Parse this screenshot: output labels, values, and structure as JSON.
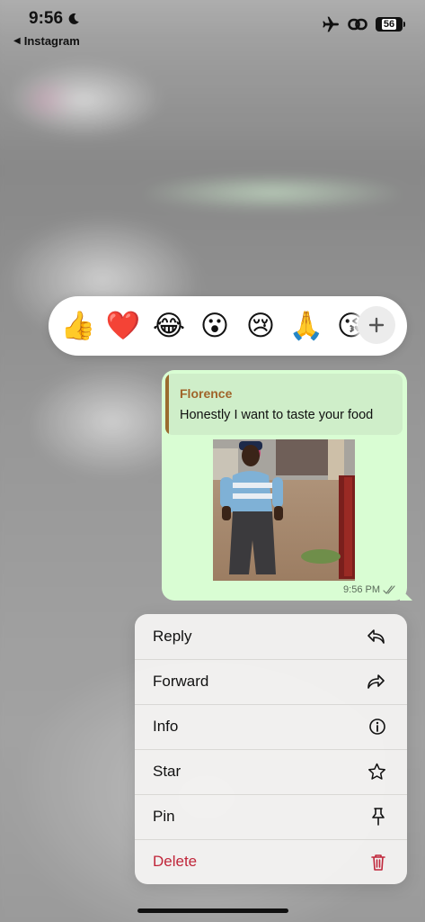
{
  "status_bar": {
    "time": "9:56",
    "back_app": "Instagram",
    "battery": "56"
  },
  "reactions": {
    "items": [
      {
        "emoji": "👍",
        "name": "thumbs-up"
      },
      {
        "emoji": "❤️",
        "name": "red-heart"
      },
      {
        "emoji": "😂",
        "name": "tears-of-joy"
      },
      {
        "emoji": "😮",
        "name": "open-mouth"
      },
      {
        "emoji": "😢",
        "name": "crying-face"
      },
      {
        "emoji": "🙏",
        "name": "folded-hands"
      },
      {
        "emoji": "😘",
        "name": "face-blowing-kiss"
      }
    ],
    "add_icon": "plus-icon"
  },
  "message": {
    "quoted_author": "Florence",
    "quoted_text": "Honestly I want to taste your food",
    "image_description_icon": "photo",
    "time": "9:56 PM",
    "status_icon": "double-check-icon",
    "colors": {
      "bubble": "#d9fdd3",
      "quote_author": "#a0642a",
      "quote_bar": "#9a6b2f"
    }
  },
  "menu": {
    "items": [
      {
        "label": "Reply",
        "icon": "reply-icon"
      },
      {
        "label": "Forward",
        "icon": "forward-icon"
      },
      {
        "label": "Info",
        "icon": "info-icon"
      },
      {
        "label": "Star",
        "icon": "star-icon"
      },
      {
        "label": "Pin",
        "icon": "pin-icon"
      },
      {
        "label": "Delete",
        "icon": "trash-icon"
      }
    ],
    "danger_color": "#c0263a"
  }
}
